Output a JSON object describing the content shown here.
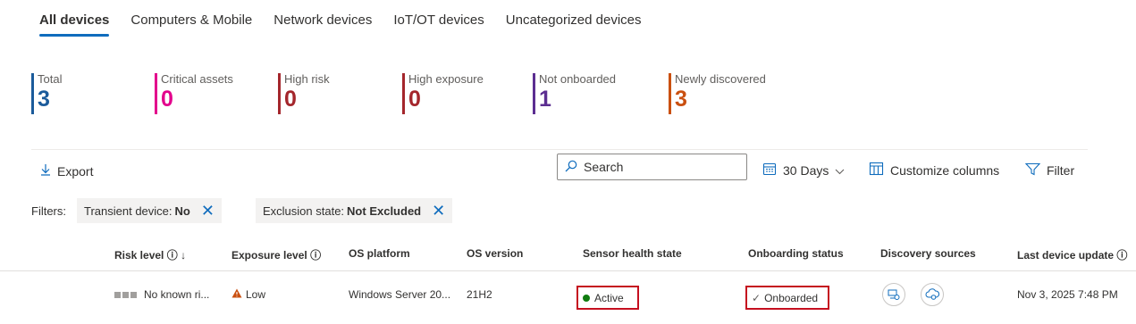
{
  "tabs": [
    {
      "label": "All devices"
    },
    {
      "label": "Computers & Mobile"
    },
    {
      "label": "Network devices"
    },
    {
      "label": "IoT/OT devices"
    },
    {
      "label": "Uncategorized devices"
    }
  ],
  "stats": [
    {
      "label": "Total",
      "value": "3",
      "color": "#1b5b9b"
    },
    {
      "label": "Critical assets",
      "value": "0",
      "color": "#e3008c"
    },
    {
      "label": "High risk",
      "value": "0",
      "color": "#a4262c"
    },
    {
      "label": "High exposure",
      "value": "0",
      "color": "#a4262c"
    },
    {
      "label": "Not onboarded",
      "value": "1",
      "color": "#5c2e91"
    },
    {
      "label": "Newly discovered",
      "value": "3",
      "color": "#ca5010"
    }
  ],
  "toolbar": {
    "export_label": "Export",
    "search_placeholder": "Search",
    "days_label": "30 Days",
    "customize_label": "Customize columns",
    "filter_label": "Filter"
  },
  "filters": {
    "label": "Filters:",
    "chips": [
      {
        "key": "Transient device:",
        "value": "No"
      },
      {
        "key": "Exclusion state:",
        "value": "Not Excluded"
      }
    ]
  },
  "table": {
    "headers": {
      "risk": "Risk level",
      "exposure": "Exposure level",
      "os_platform": "OS platform",
      "os_version": "OS version",
      "sensor": "Sensor health state",
      "onboarding": "Onboarding status",
      "discovery": "Discovery sources",
      "last_update": "Last device update"
    },
    "rows": [
      {
        "risk": "No known ri...",
        "exposure": "Low",
        "os_platform": "Windows Server 20...",
        "os_version": "21H2",
        "sensor": "Active",
        "onboarding": "Onboarded",
        "last_update": "Nov 3, 2025 7:48 PM"
      }
    ]
  }
}
